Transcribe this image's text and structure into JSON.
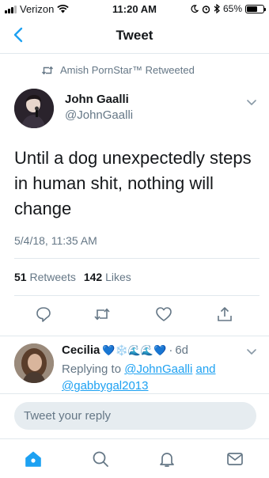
{
  "status_bar": {
    "carrier": "Verizon",
    "time": "11:20 AM",
    "battery": "65%",
    "battery_level": 0.65
  },
  "nav": {
    "title": "Tweet",
    "back_icon": "chevron-left-icon"
  },
  "retweet": {
    "icon": "retweet-icon",
    "text": "Amish PornStar™ Retweeted"
  },
  "tweet": {
    "author_name": "John Gaalli",
    "author_handle": "@JohnGaalli",
    "text": "Until a dog unexpectedly steps in human shit, nothing will change",
    "date": "5/4/18, 11:35 AM",
    "retweets_count": "51",
    "retweets_label": "Retweets",
    "likes_count": "142",
    "likes_label": "Likes"
  },
  "actions": [
    "reply-icon",
    "retweet-icon",
    "like-icon",
    "share-icon"
  ],
  "reply": {
    "name": "Cecilia",
    "emojis": "💙❄️🌊🌊💙",
    "separator": "·",
    "time": "6d",
    "replying_prefix": "Replying to",
    "mention_1": "@JohnGaalli",
    "and_word": "and",
    "mention_2": "@gabbygal2013"
  },
  "composer": {
    "placeholder": "Tweet your reply"
  },
  "tabbar": [
    "home-icon",
    "search-icon",
    "notifications-icon",
    "messages-icon"
  ],
  "colors": {
    "accent": "#1da1f2",
    "text": "#14171a",
    "secondary": "#657786",
    "divider": "#e1e8ed"
  }
}
